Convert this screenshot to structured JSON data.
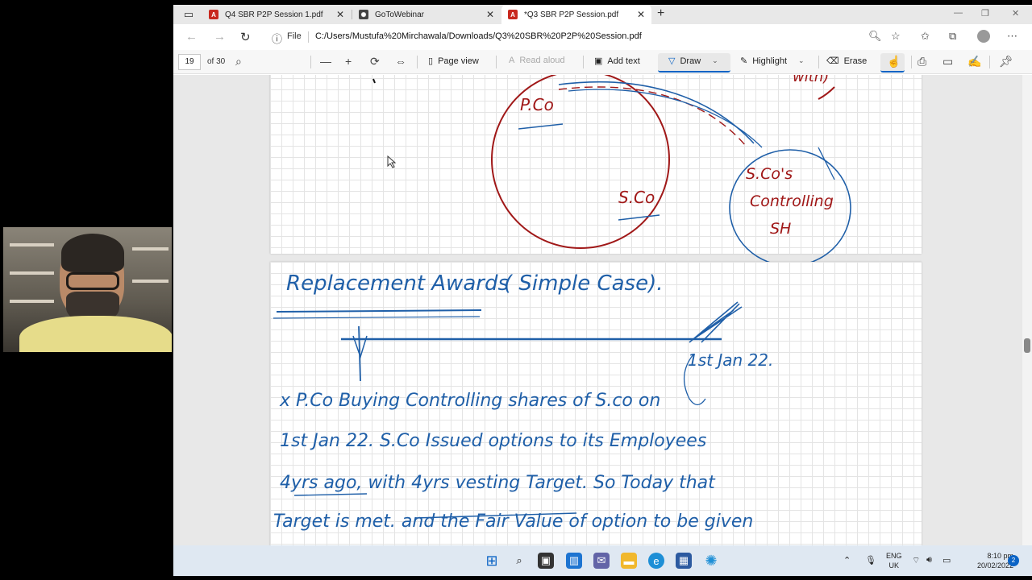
{
  "webcam": {
    "description_icon": "person-video-icon"
  },
  "tabs": [
    {
      "title": "Q4 SBR P2P Session 1.pdf",
      "icon": "pdf-icon"
    },
    {
      "title": "GoToWebinar",
      "icon": "gotowebinar-icon"
    },
    {
      "title": "*Q3 SBR P2P Session.pdf",
      "icon": "pdf-icon"
    }
  ],
  "address": {
    "scheme_label": "File",
    "url": "C:/Users/Mustufa%20Mirchawala/Downloads/Q3%20SBR%20P2P%20Session.pdf"
  },
  "pdf_toolbar": {
    "page_number": "19",
    "page_total": "of 30",
    "page_view": "Page view",
    "read_aloud": "Read aloud",
    "add_text": "Add text",
    "draw": "Draw",
    "highlight": "Highlight",
    "erase": "Erase"
  },
  "notes": {
    "page1": {
      "pco": "P.Co",
      "sco": "S.Co",
      "sco_sh": [
        "S.Co's",
        "Controlling",
        "SH"
      ],
      "top_right": "with)"
    },
    "page2": {
      "title": "Replacement Awards",
      "subtitle": "( Simple Case).",
      "date_label": "1st Jan 22.",
      "lines": [
        "x P.Co Buying Controlling shares of S.co on",
        "1st Jan 22. S.Co Issued options to its Employees",
        "4yrs ago, with 4yrs vesting Target. So Today that",
        "Target is met. and the Fair Value of option to be given"
      ]
    }
  },
  "taskbar": {
    "lang": "ENG",
    "region": "UK",
    "time": "8:10 pm",
    "date": "20/02/2022",
    "notifications": "2"
  },
  "colors": {
    "ink_red": "#a01818",
    "ink_blue": "#1f5fa8",
    "accent": "#0b63c5"
  }
}
